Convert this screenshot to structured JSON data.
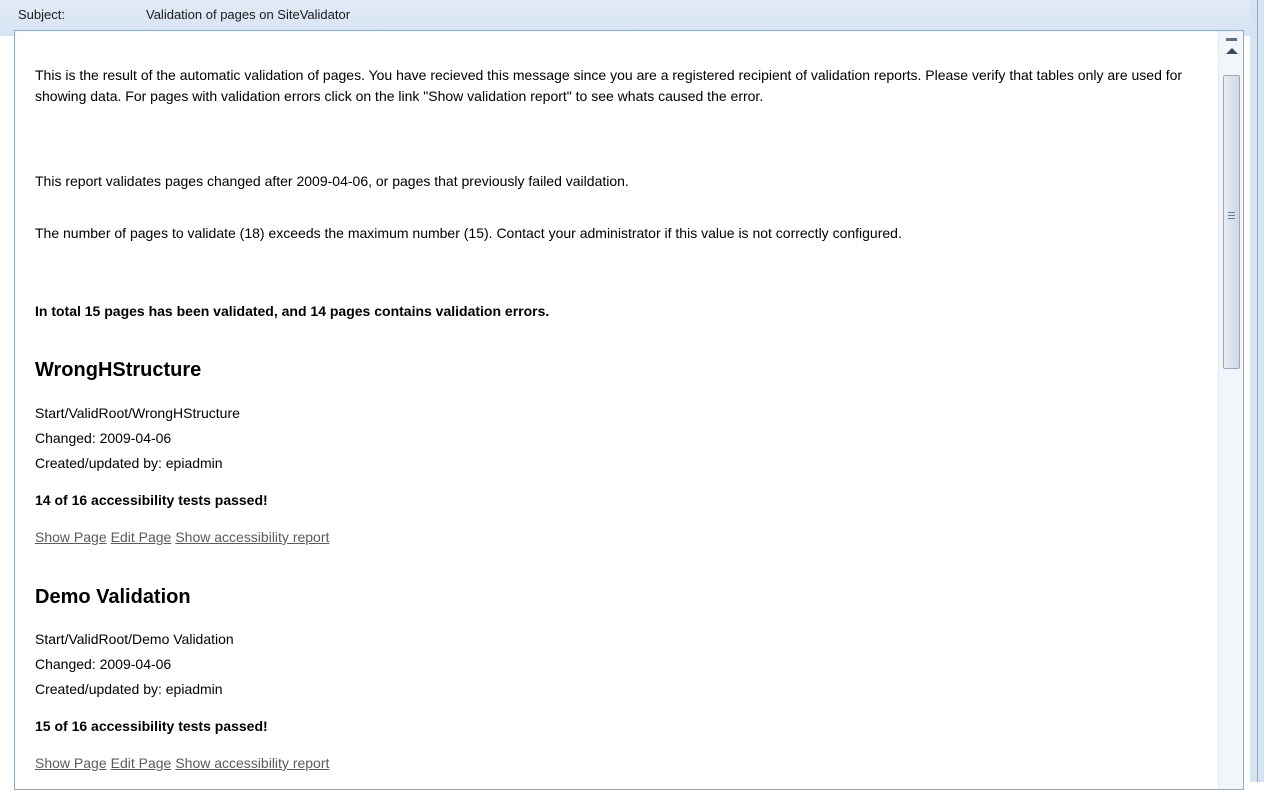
{
  "header": {
    "subject_label": "Subject:",
    "subject_value": "Validation of pages on SiteValidator"
  },
  "message": {
    "intro": "This is the result of the automatic validation of pages. You have recieved this message since you are a registered recipient of validation reports. Please verify that tables only are used for showing data. For pages with validation errors click on the link \"Show validation report\" to see whats caused the error.",
    "changed_after": "This report validates pages changed after 2009-04-06, or pages that previously failed vaildation.",
    "max_warning": "The number of pages to validate (18) exceeds the maximum number (15). Contact your administrator if this value is not correctly configured.",
    "summary": "In total 15 pages has been validated, and 14 pages contains validation errors."
  },
  "pages": [
    {
      "title": "WrongHStructure",
      "path": "Start/ValidRoot/WrongHStructure",
      "changed": "Changed: 2009-04-06",
      "author": "Created/updated by: epiadmin",
      "result": "14 of 16 accessibility tests passed!",
      "links": [
        "Show Page",
        "Edit Page",
        "Show accessibility report"
      ]
    },
    {
      "title": "Demo Validation",
      "path": "Start/ValidRoot/Demo Validation",
      "changed": "Changed: 2009-04-06",
      "author": "Created/updated by: epiadmin",
      "result": "15 of 16 accessibility tests passed!",
      "links": [
        "Show Page",
        "Edit Page",
        "Show accessibility report"
      ]
    }
  ],
  "icons": {
    "scroll_up": "arrow-up-icon",
    "scroll_grip": "grip-icon"
  }
}
